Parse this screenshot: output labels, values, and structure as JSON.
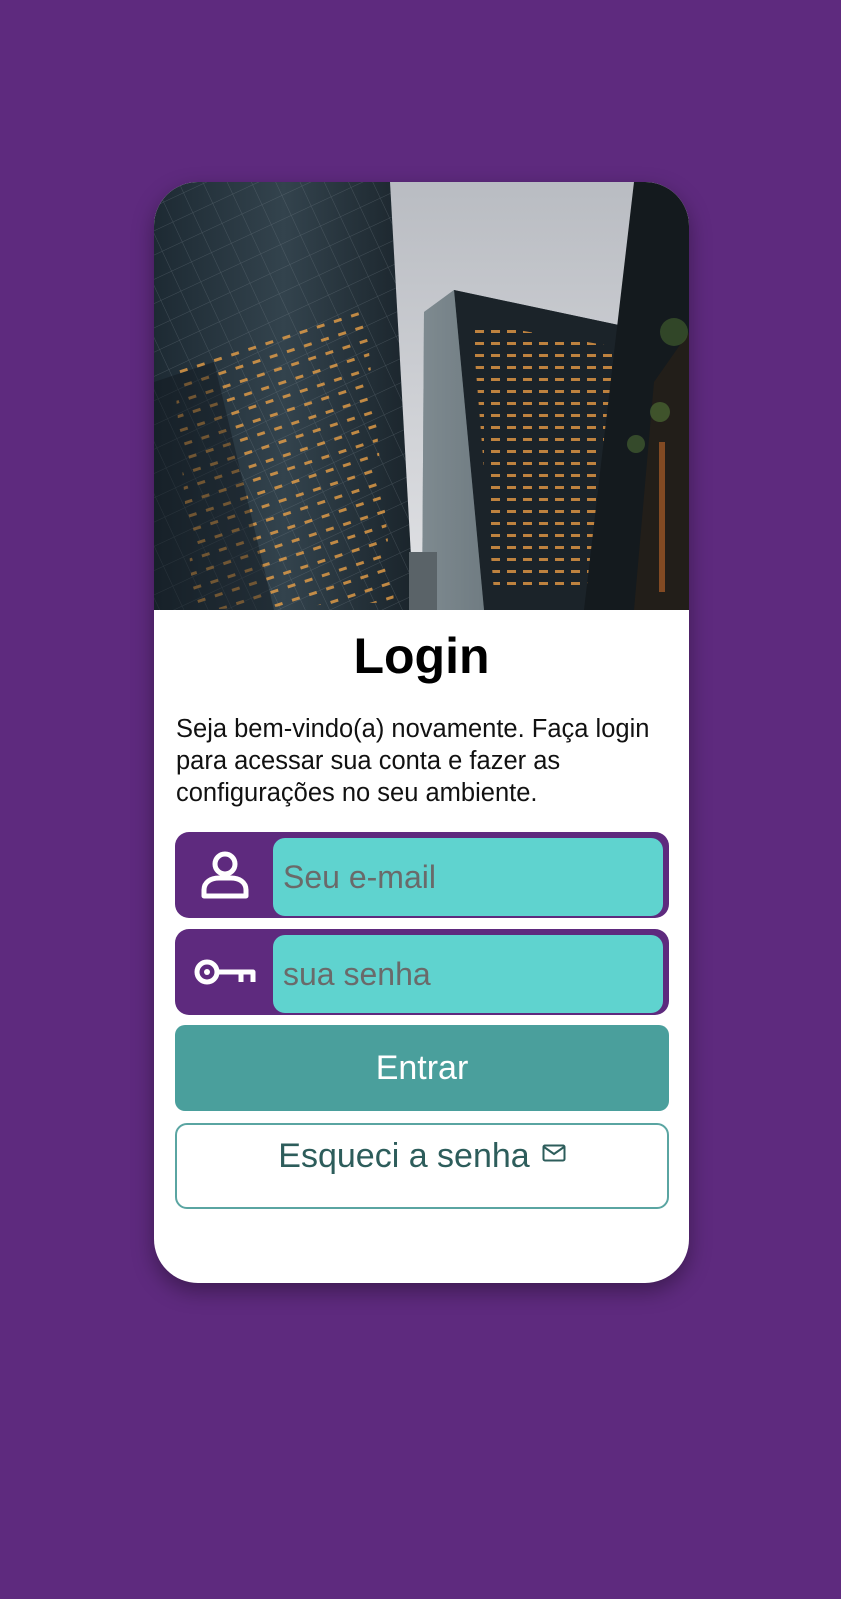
{
  "page": {
    "background": "#5e2a7e"
  },
  "card": {
    "hero_image": "city-skyscrapers-photo",
    "title": "Login",
    "subtitle": "Seja bem-vindo(a) novamente. Faça login para acessar sua conta e fazer as configurações no seu ambiente."
  },
  "form": {
    "email": {
      "icon": "user-icon",
      "placeholder": "Seu e-mail",
      "value": ""
    },
    "password": {
      "icon": "key-icon",
      "placeholder": "sua senha",
      "value": ""
    },
    "submit_label": "Entrar",
    "forgot_label": "Esqueci a senha",
    "forgot_icon": "mail-icon"
  },
  "colors": {
    "field_background": "#5e2a7e",
    "input_fill": "#5fd3cf",
    "primary_button": "#4a9f9c",
    "secondary_border": "#5aa5a2",
    "secondary_text": "#2d5d5b"
  }
}
